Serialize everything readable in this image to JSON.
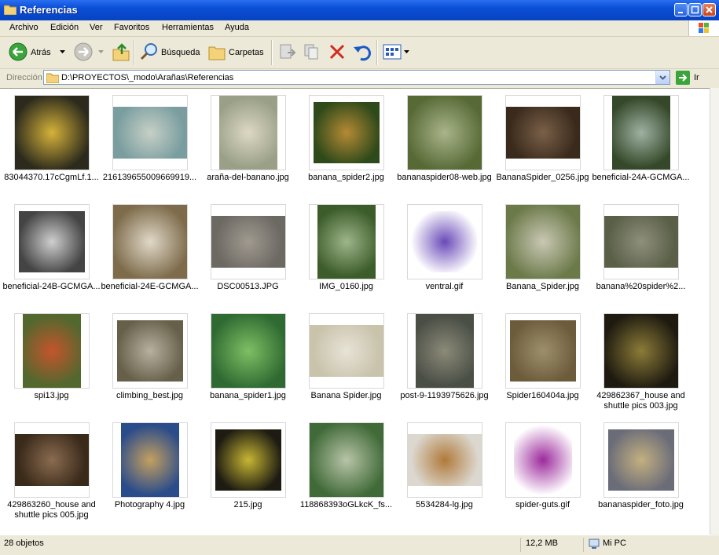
{
  "window": {
    "title": "Referencias"
  },
  "menu": [
    "Archivo",
    "Edición",
    "Ver",
    "Favoritos",
    "Herramientas",
    "Ayuda"
  ],
  "toolbar": {
    "back": "Atrás",
    "search": "Búsqueda",
    "folders": "Carpetas"
  },
  "address": {
    "label": "Dirección",
    "path": "D:\\PROYECTOS\\_modo\\Arañas\\Referencias",
    "go": "Ir"
  },
  "files": [
    {
      "name": "83044370.17cCgmLf.1...",
      "colors": [
        "#2b2a1c",
        "#d6b23a"
      ]
    },
    {
      "name": "216139655009669919...",
      "colors": [
        "#7a9ea0",
        "#c7d0c6"
      ]
    },
    {
      "name": "araña-del-banano.jpg",
      "colors": [
        "#9aa088",
        "#ddd8c4"
      ]
    },
    {
      "name": "banana_spider2.jpg",
      "colors": [
        "#2f4a1a",
        "#b68a34"
      ]
    },
    {
      "name": "bananaspider08-web.jpg",
      "colors": [
        "#576a36",
        "#a9b48a"
      ]
    },
    {
      "name": "BananaSpider_0256.jpg",
      "colors": [
        "#3a2a1c",
        "#7a6048"
      ]
    },
    {
      "name": "beneficial-24A-GCMGA...",
      "colors": [
        "#35492a",
        "#9fb2a3"
      ]
    },
    {
      "name": "beneficial-24B-GCMGA...",
      "colors": [
        "#444",
        "#cfcfcf"
      ]
    },
    {
      "name": "beneficial-24E-GCMGA...",
      "colors": [
        "#7d6b4a",
        "#e0d8c8"
      ]
    },
    {
      "name": "DSC00513.JPG",
      "colors": [
        "#6c6862",
        "#a09a90"
      ]
    },
    {
      "name": "IMG_0160.jpg",
      "colors": [
        "#3c5c2a",
        "#9db58a"
      ]
    },
    {
      "name": "ventral.gif",
      "colors": [
        "#ffffff",
        "#6a4ab8"
      ]
    },
    {
      "name": "Banana_Spider.jpg",
      "colors": [
        "#6c7a4a",
        "#c9c8b4"
      ]
    },
    {
      "name": "banana%20spider%2...",
      "colors": [
        "#5a6048",
        "#8e8f7c"
      ]
    },
    {
      "name": "spi13.jpg",
      "colors": [
        "#52682e",
        "#c5542c"
      ]
    },
    {
      "name": "climbing_best.jpg",
      "colors": [
        "#66604a",
        "#b8b0a0"
      ]
    },
    {
      "name": "banana_spider1.jpg",
      "colors": [
        "#2e6a32",
        "#7fbf64"
      ]
    },
    {
      "name": "Banana Spider.jpg",
      "colors": [
        "#c9c3ac",
        "#e7e3d6"
      ]
    },
    {
      "name": "post-9-1193975626.jpg",
      "colors": [
        "#4a4f46",
        "#8c8a78"
      ]
    },
    {
      "name": "Spider160404a.jpg",
      "colors": [
        "#6c5c3c",
        "#9e8f6c"
      ]
    },
    {
      "name": "429862367_house and shuttle pics 003.jpg",
      "colors": [
        "#1e1a10",
        "#8c7c38"
      ]
    },
    {
      "name": "429863260_house and shuttle pics 005.jpg",
      "colors": [
        "#3a2a1a",
        "#8a6c50"
      ]
    },
    {
      "name": "Photography 4.jpg",
      "colors": [
        "#2b4c8a",
        "#c4a060"
      ]
    },
    {
      "name": "215.jpg",
      "colors": [
        "#1e1c12",
        "#c8b634"
      ]
    },
    {
      "name": "118868393oGLkcK_fs...",
      "colors": [
        "#406a38",
        "#b8c4a8"
      ]
    },
    {
      "name": "5534284-lg.jpg",
      "colors": [
        "#dcd8d0",
        "#b07a3a"
      ]
    },
    {
      "name": "spider-guts.gif",
      "colors": [
        "#ffffff",
        "#9c2a9c"
      ]
    },
    {
      "name": "bananaspider_foto.jpg",
      "colors": [
        "#6a6c78",
        "#c4b080"
      ]
    }
  ],
  "status": {
    "count": "28 objetos",
    "size": "12,2 MB",
    "location": "Mi PC"
  }
}
